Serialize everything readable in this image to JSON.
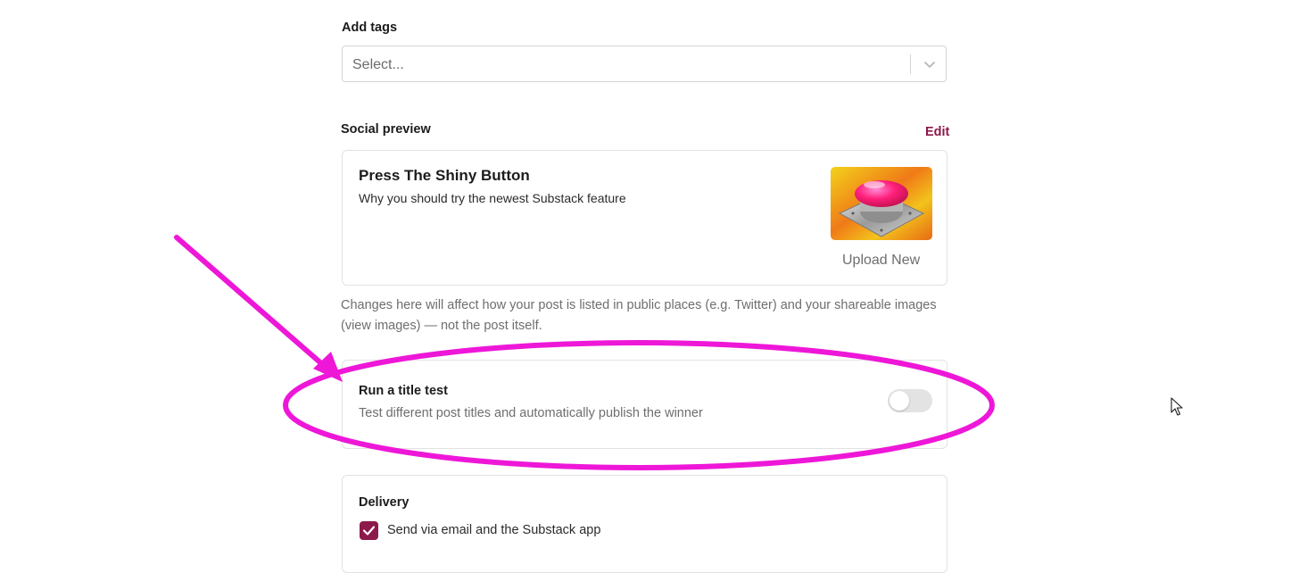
{
  "tags": {
    "label": "Add tags",
    "placeholder": "Select..."
  },
  "social_preview": {
    "label": "Social preview",
    "edit_label": "Edit",
    "post_title": "Press The Shiny Button",
    "post_subtitle": "Why you should try the newest Substack feature",
    "upload_label": "Upload New",
    "help_text": "Changes here will affect how your post is listed in public places (e.g. Twitter) and your shareable images (view images) — not the post itself."
  },
  "title_test": {
    "title": "Run a title test",
    "description": "Test different post titles and automatically publish the winner",
    "enabled": false
  },
  "delivery": {
    "title": "Delivery",
    "option_label": "Send via email and the Substack app",
    "option_checked": true
  },
  "colors": {
    "accent": "#8c1a4a",
    "annotation": "#ee17d8"
  },
  "icons": {
    "select_chevron": "chevron-down-icon",
    "checkbox_check": "check-icon",
    "cursor": "mouse-pointer-icon"
  }
}
